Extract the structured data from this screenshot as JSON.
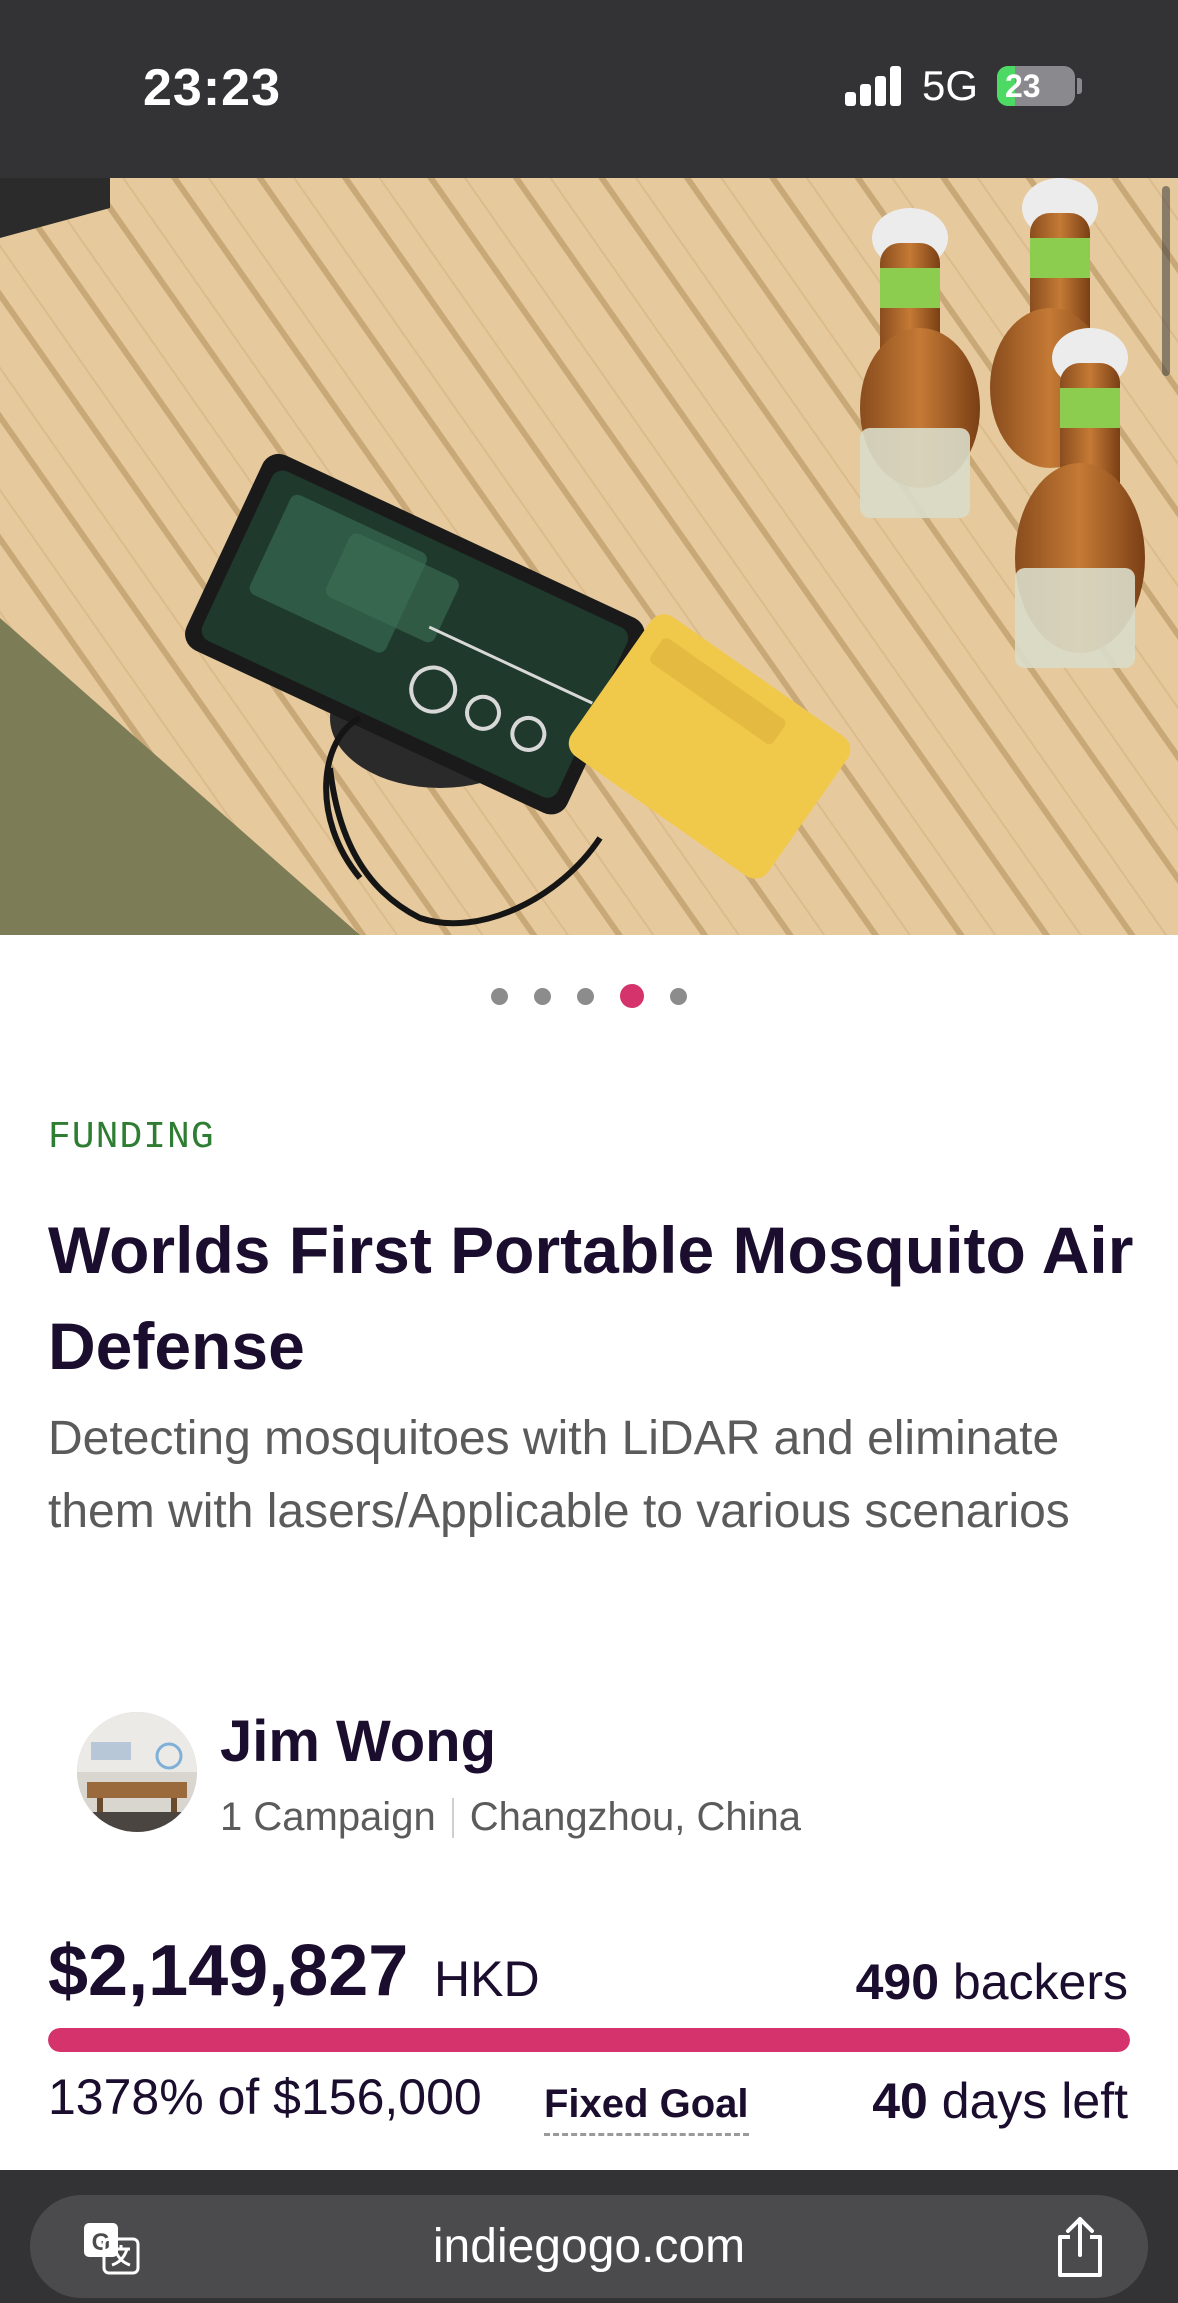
{
  "status_bar": {
    "time": "23:23",
    "network": "5G",
    "battery": "23"
  },
  "hero_image": {
    "description": "Product photo: black device on wooden table with bottles and yellow power bank",
    "carousel": {
      "count": 5,
      "active_index": 3
    }
  },
  "campaign": {
    "category": "FUNDING",
    "title": "Worlds First Portable Mosquito Air Defense",
    "subtitle": "Detecting mosquitoes with LiDAR and eliminate them with lasers/Applicable to various scenarios"
  },
  "owner": {
    "name": "Jim Wong",
    "campaigns": "1 Campaign",
    "location": "Changzhou, China"
  },
  "funding": {
    "amount": "$2,149,827",
    "currency": "HKD",
    "backers_count": "490",
    "backers_label": "backers",
    "percent_of_goal": "1378% of $156,000",
    "goal_type": "Fixed Goal",
    "days_count": "40",
    "days_label": "days left",
    "progress_fraction": 1.0
  },
  "browser": {
    "url": "indiegogo.com"
  },
  "colors": {
    "accent": "#d4336b",
    "category_green": "#2e7d32",
    "title": "#1b0d2e",
    "browser_bar": "#333336"
  }
}
